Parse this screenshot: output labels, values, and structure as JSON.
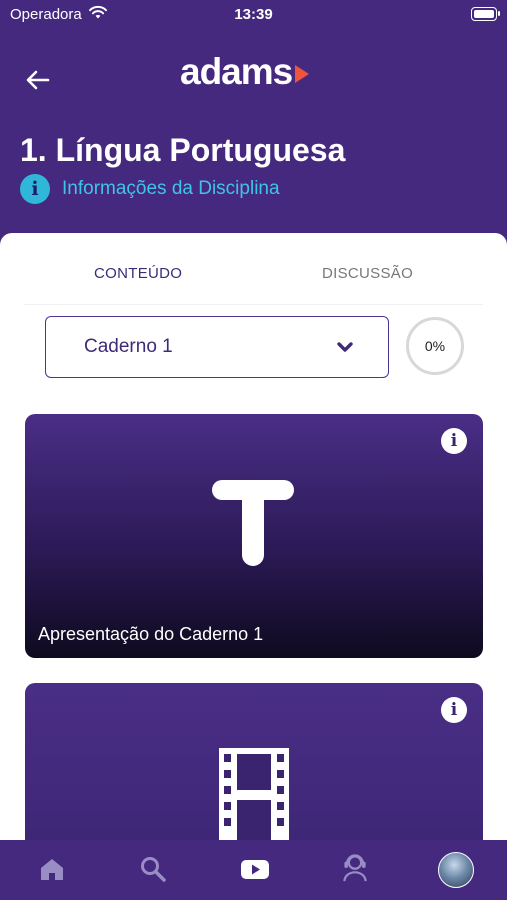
{
  "status_bar": {
    "carrier": "Operadora",
    "time": "13:39"
  },
  "header": {
    "logo_text": "adams",
    "title": "1. Língua Portuguesa",
    "info_link_label": "Informações da Disciplina"
  },
  "tabs": [
    {
      "label": "CONTEÚDO",
      "active": true
    },
    {
      "label": "DISCUSSÃO",
      "active": false
    }
  ],
  "notebook_select": {
    "selected": "Caderno 1"
  },
  "progress": {
    "label": "0%",
    "value": 0
  },
  "cards": [
    {
      "title": "Apresentação do Caderno 1",
      "icon": "text-type-icon"
    },
    {
      "title": "",
      "icon": "film-icon"
    }
  ],
  "bottom_nav": [
    {
      "icon": "home-icon"
    },
    {
      "icon": "search-icon"
    },
    {
      "icon": "video-play-icon"
    },
    {
      "icon": "support-agent-icon"
    },
    {
      "icon": "avatar"
    }
  ],
  "colors": {
    "brand_purple": "#45297f",
    "accent_cyan": "#2fb6d9",
    "logo_play": "#f0553b"
  }
}
